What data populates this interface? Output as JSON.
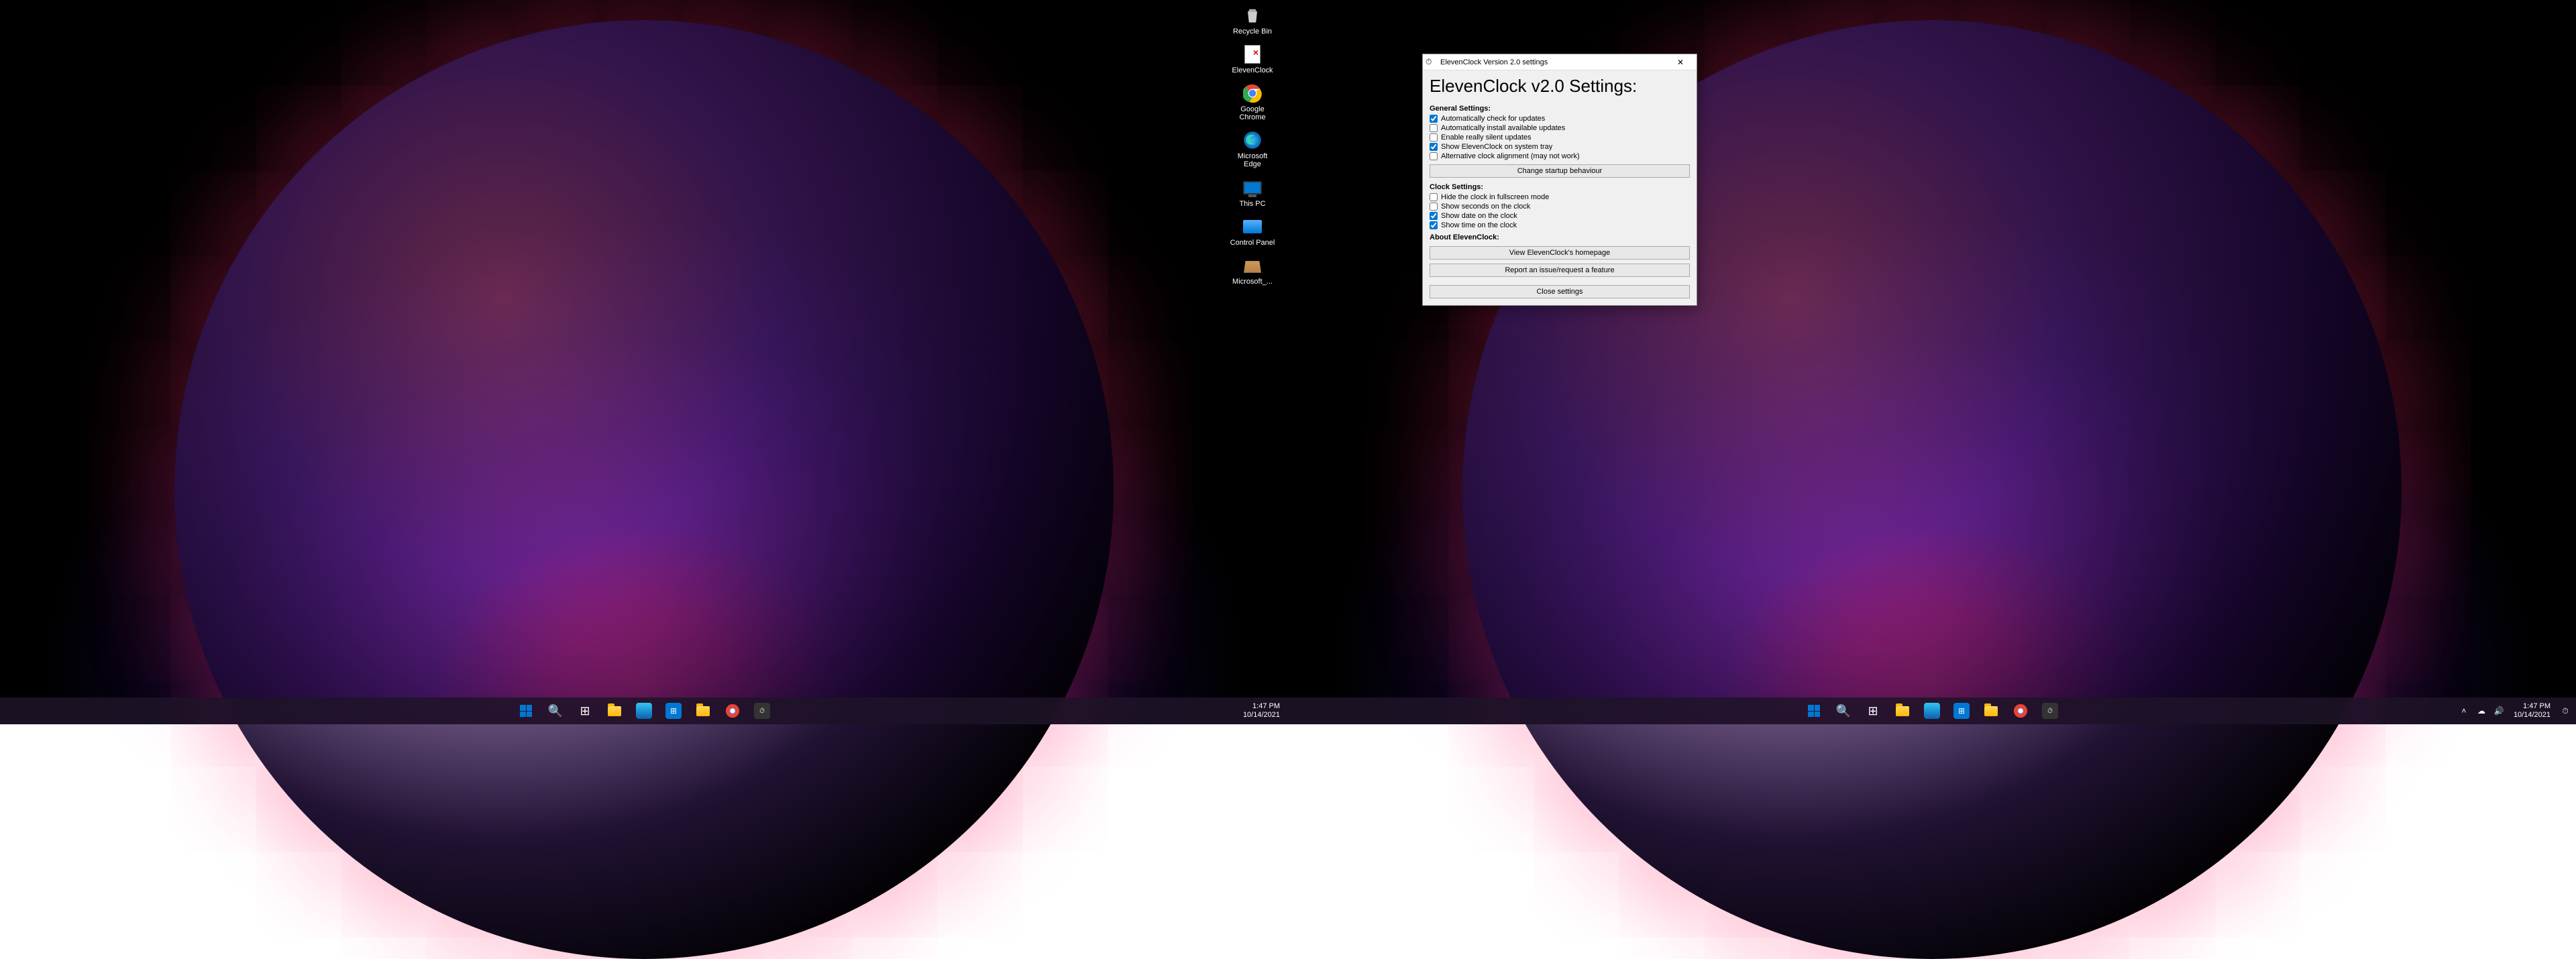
{
  "desktop_icons": [
    {
      "name": "recycle-bin",
      "label": "Recycle Bin"
    },
    {
      "name": "elevenclock",
      "label": "ElevenClock"
    },
    {
      "name": "google-chrome",
      "label": "Google Chrome"
    },
    {
      "name": "microsoft-edge",
      "label": "Microsoft Edge"
    },
    {
      "name": "this-pc",
      "label": "This PC"
    },
    {
      "name": "control-panel",
      "label": "Control Panel"
    },
    {
      "name": "microsoft-folder",
      "label": "Microsoft_..."
    }
  ],
  "clock": {
    "time": "1:47 PM",
    "date": "10/14/2021"
  },
  "settings": {
    "titlebar": "ElevenClock Version 2.0 settings",
    "heading": "ElevenClock v2.0 Settings:",
    "general_title": "General Settings:",
    "general_opts": [
      {
        "label": "Automatically check for updates",
        "checked": true
      },
      {
        "label": "Automatically install available updates",
        "checked": false
      },
      {
        "label": "Enable really silent updates",
        "checked": false
      },
      {
        "label": "Show ElevenClock on system tray",
        "checked": true
      },
      {
        "label": "Alternative clock alignment (may not work)",
        "checked": false
      }
    ],
    "change_startup": "Change startup behaviour",
    "clock_title": "Clock Settings:",
    "clock_opts": [
      {
        "label": "Hide the clock in fullscreen mode",
        "checked": false
      },
      {
        "label": "Show seconds on the clock",
        "checked": false
      },
      {
        "label": "Show date on the clock",
        "checked": true
      },
      {
        "label": "Show time on the clock",
        "checked": true
      }
    ],
    "about_title": "About ElevenClock:",
    "view_homepage": "View ElevenClock's homepage",
    "report_issue": "Report an issue/request a feature",
    "close_settings": "Close settings"
  }
}
